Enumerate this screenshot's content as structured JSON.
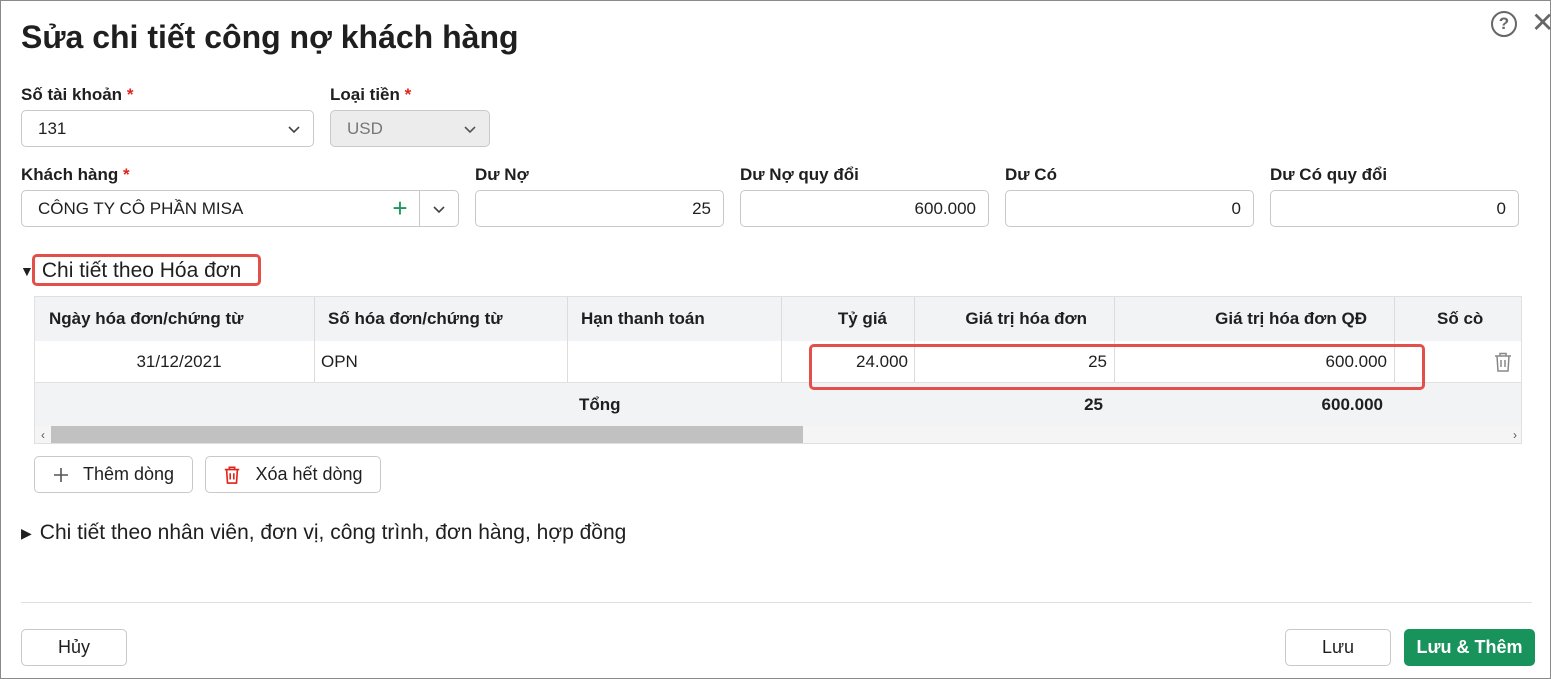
{
  "dialog": {
    "title": "Sửa chi tiết công nợ khách hàng",
    "help_icon": "?",
    "close_icon": "✕"
  },
  "form": {
    "account": {
      "label": "Số tài khoản",
      "required": "*",
      "value": "131"
    },
    "currency": {
      "label": "Loại tiền",
      "required": "*",
      "value": "USD"
    },
    "customer": {
      "label": "Khách hàng",
      "required": "*",
      "value": "CÔNG TY CÔ PHẦN MISA"
    },
    "debit": {
      "label": "Dư Nợ",
      "value": "25"
    },
    "debit_converted": {
      "label": "Dư Nợ quy đổi",
      "value": "600.000"
    },
    "credit": {
      "label": "Dư Có",
      "value": "0"
    },
    "credit_converted": {
      "label": "Dư Có quy đổi",
      "value": "0"
    }
  },
  "invoice_section": {
    "title": "Chi tiết theo Hóa đơn",
    "columns": [
      "Ngày hóa đơn/chứng từ",
      "Số hóa đơn/chứng từ",
      "Hạn thanh toán",
      "Tỷ giá",
      "Giá trị hóa đơn",
      "Giá trị hóa đơn QĐ",
      "Số cò"
    ],
    "rows": [
      {
        "date": "31/12/2021",
        "number": "OPN",
        "due": "",
        "rate": "24.000",
        "amount": "25",
        "amount_converted": "600.000"
      }
    ],
    "total": {
      "label": "Tổng",
      "amount": "25",
      "amount_converted": "600.000"
    },
    "add_row_label": "Thêm dòng",
    "delete_all_label": "Xóa hết dòng"
  },
  "other_section": {
    "title": "Chi tiết theo nhân viên, đơn vị, công trình, đơn hàng, hợp đồng"
  },
  "footer": {
    "cancel_label": "Hủy",
    "save_label": "Lưu",
    "save_add_label": "Lưu & Thêm"
  },
  "colors": {
    "primary": "#17935b",
    "highlight": "#e3504a",
    "required": "#e2231a"
  }
}
